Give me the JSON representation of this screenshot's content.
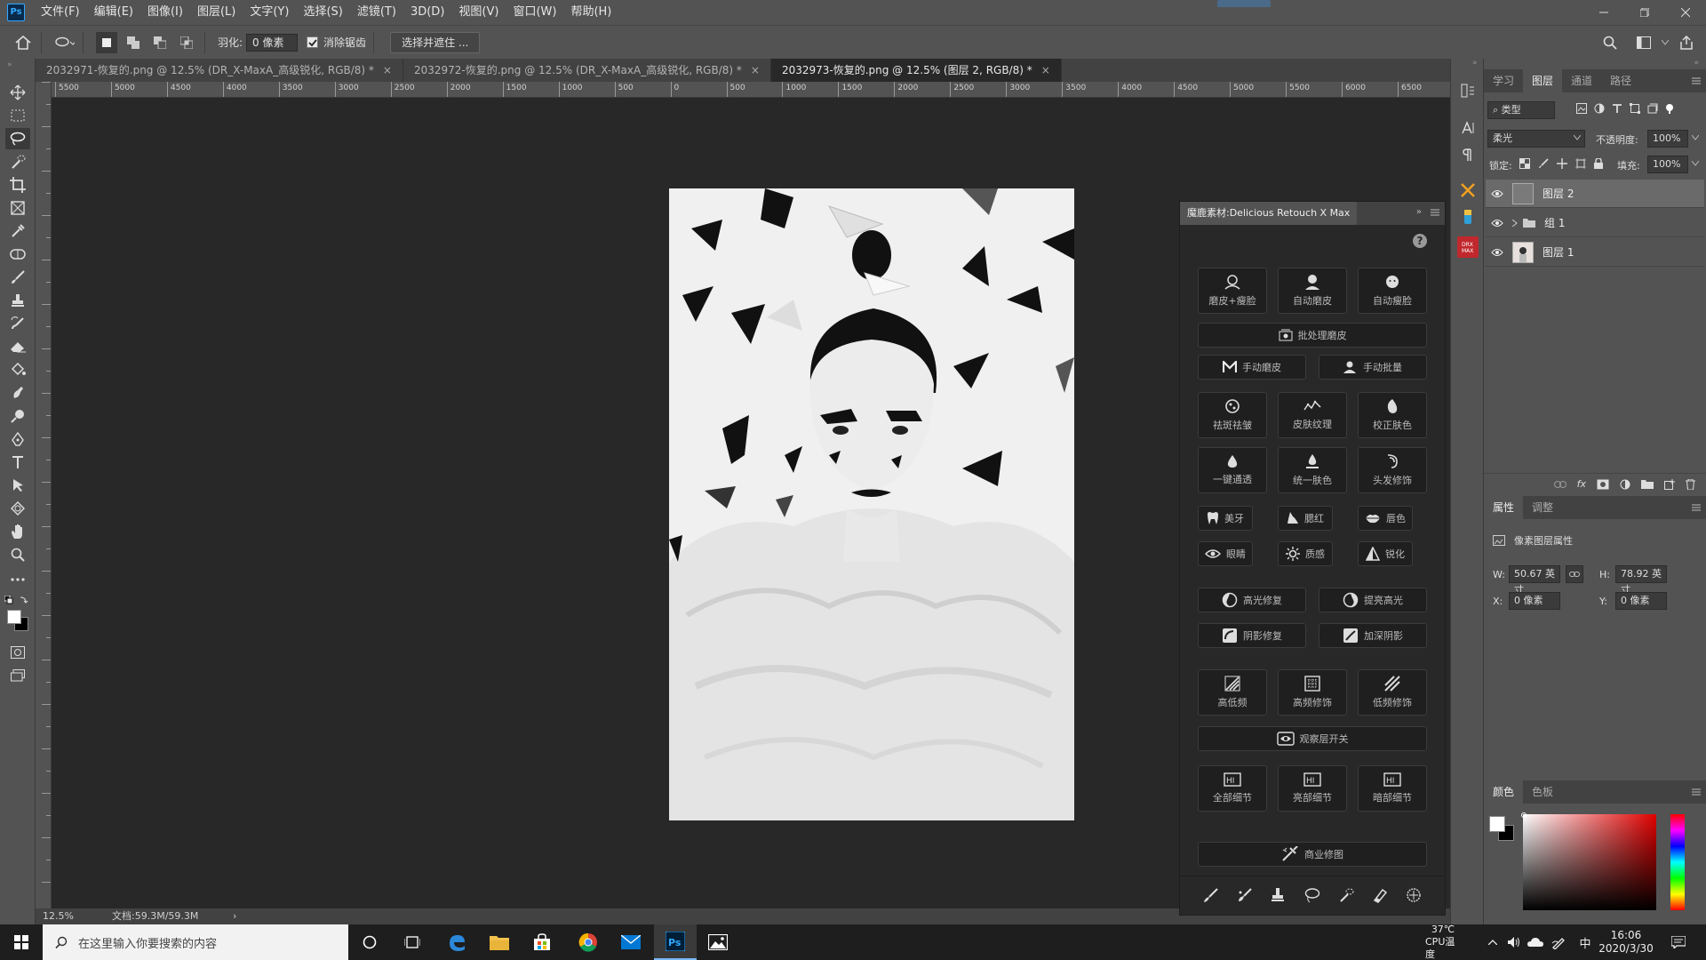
{
  "app": {
    "logo": "Ps"
  },
  "menu": [
    "文件(F)",
    "编辑(E)",
    "图像(I)",
    "图层(L)",
    "文字(Y)",
    "选择(S)",
    "滤镜(T)",
    "3D(D)",
    "视图(V)",
    "窗口(W)",
    "帮助(H)"
  ],
  "options": {
    "feather_label": "羽化:",
    "feather_value": "0 像素",
    "antialias_label": "消除锯齿",
    "select_mask_button": "选择并遮住 ..."
  },
  "documents": [
    {
      "title": "2032971-恢复的.png @ 12.5% (DR_X-MaxA_高级锐化, RGB/8) *",
      "close": "×",
      "active": false
    },
    {
      "title": "2032972-恢复的.png @ 12.5% (DR_X-MaxA_高级锐化, RGB/8) *",
      "close": "×",
      "active": false
    },
    {
      "title": "2032973-恢复的.png @ 12.5% (图层 2, RGB/8) *",
      "close": "×",
      "active": true
    }
  ],
  "ruler": {
    "top_ticks": [
      "5500",
      "5000",
      "4500",
      "4000",
      "3500",
      "3000",
      "2500",
      "2000",
      "1500",
      "1000",
      "500",
      "0",
      "500",
      "1000",
      "1500",
      "2000",
      "2500",
      "3000",
      "3500",
      "4000",
      "4500",
      "5000",
      "5500",
      "6000",
      "6500"
    ]
  },
  "status": {
    "zoom": "12.5%",
    "doc_size": "文档:59.3M/59.3M",
    "arrow": "›"
  },
  "right_panel": {
    "tabs": [
      "学习",
      "图层",
      "通道",
      "路径"
    ],
    "active_tab": "图层",
    "filter_kind": "类型",
    "blend_mode": "柔光",
    "opacity_label": "不透明度:",
    "opacity_value": "100%",
    "lock_label": "锁定:",
    "fill_label": "填充:",
    "fill_value": "100%",
    "layers": [
      {
        "name": "图层 2",
        "selected": true
      },
      {
        "name": "组 1",
        "selected": false
      },
      {
        "name": "图层 1",
        "selected": false
      }
    ],
    "props_tabs": [
      "属性",
      "调整"
    ],
    "props_title": "像素图层属性",
    "w_label": "W:",
    "w_value": "50.67 英寸",
    "h_label": "H:",
    "h_value": "78.92 英寸",
    "x_label": "X:",
    "x_value": "0 像素",
    "y_label": "Y:",
    "y_value": "0 像素",
    "color_tabs": [
      "颜色",
      "色板"
    ]
  },
  "plugin": {
    "title": "魔鹿素材:Delicious Retouch X Max",
    "help": "?",
    "buttons": {
      "b1": "磨皮+瘦脸",
      "b2": "自动磨皮",
      "b3": "自动瘦脸",
      "batch": "批处理磨皮",
      "manual": "手动磨皮",
      "manual_batch": "手动批量",
      "spots": "祛斑祛皱",
      "texture": "皮肤纹理",
      "correct": "校正肤色",
      "oneclick": "一键通透",
      "unify": "统一肤色",
      "hair": "头发修饰",
      "teeth": "美牙",
      "blush": "腮红",
      "lips": "唇色",
      "eyes": "眼睛",
      "quality": "质感",
      "sharpen": "锐化",
      "hl_fix": "高光修复",
      "hl_up": "提亮高光",
      "sh_fix": "阴影修复",
      "sh_deep": "加深阴影",
      "hilo": "高低频",
      "hifreq": "高频修饰",
      "lofreq": "低频修饰",
      "observe": "观察层开关",
      "all_detail": "全部细节",
      "bright_detail": "亮部细节",
      "dark_detail": "暗部细节",
      "commercial": "商业修图"
    }
  },
  "taskbar": {
    "search_placeholder": "在这里输入你要搜索的内容",
    "temp": "37℃",
    "cpu": "CPU温度",
    "ime": "中",
    "time": "16:06",
    "date": "2020/3/30"
  },
  "colors": {
    "ui_bg": "#535353",
    "canvas": "#282828",
    "accent": "#31a8ff",
    "plugin_bg": "#282828"
  }
}
